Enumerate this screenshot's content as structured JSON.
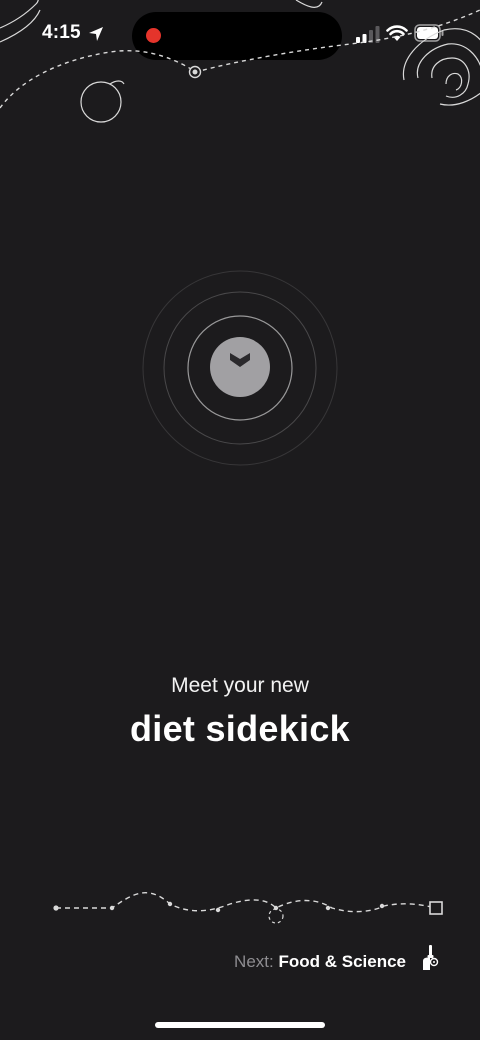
{
  "status_bar": {
    "time": "4:15",
    "icons": [
      "location-arrow-icon",
      "recording-dot",
      "cellular-signal-icon",
      "wifi-icon",
      "battery-icon"
    ],
    "recording_color": "#e5342b"
  },
  "logo": {
    "icon": "heart-chevron-logo-icon",
    "circle_color": "#a1a0a3"
  },
  "headline": {
    "subtitle": "Meet your new",
    "title": "diet sidekick"
  },
  "progress": {
    "icon": "dotted-journey-path",
    "current_step": 1
  },
  "next": {
    "label": "Next:",
    "value": "Food & Science",
    "icon": "beaker-pipette-icon"
  },
  "colors": {
    "background": "#1c1b1d",
    "text": "#ffffff",
    "muted": "#8e8d91"
  }
}
